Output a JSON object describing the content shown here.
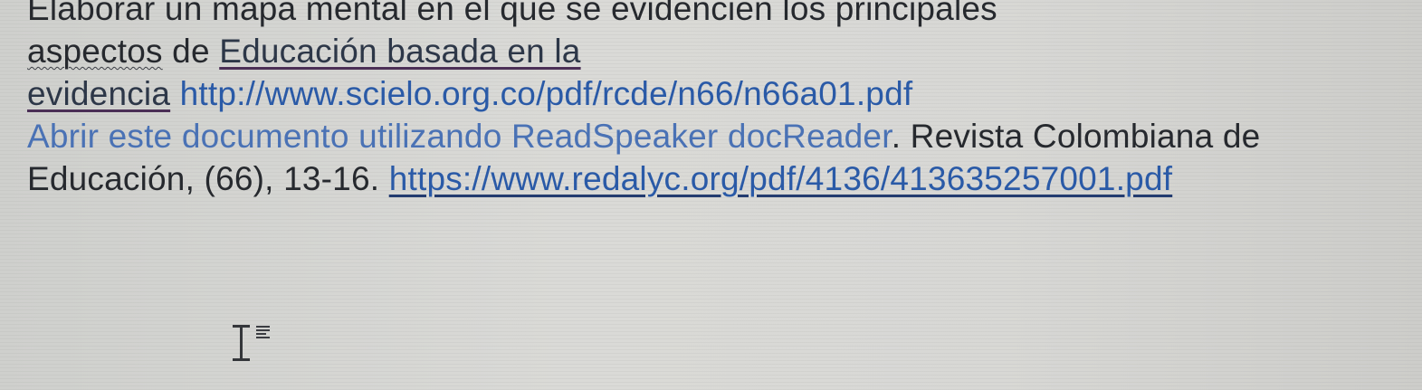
{
  "document": {
    "line1": "Elaborar un mapa mental en el que se evidencien los principales",
    "line2_prefix": "aspectos",
    "line2_mid": " de  ",
    "line2_link": "Educación basada en la",
    "line3_link_word": "evidencia",
    "line3_url": "http://www.scielo.org.co/pdf/rcde/n66/n66a01.pdf",
    "line4_reader_link": "Abrir este documento utilizando ReadSpeaker docReader",
    "line4_after": ". Revista Colombiana de",
    "line5_text": "Educación, (66), 13-16. ",
    "line5_url": "https://www.redalyc.org/pdf/4136/413635257001.pdf"
  },
  "cursor": {
    "icon": "text-cursor-icon",
    "badge_icon": "align-lines-icon"
  },
  "colors": {
    "background": "#d6d6d3",
    "text": "#26292e",
    "link": "#2a5aa7",
    "reader_link": "#4a72b5",
    "link_underline": "#6a2f56"
  }
}
